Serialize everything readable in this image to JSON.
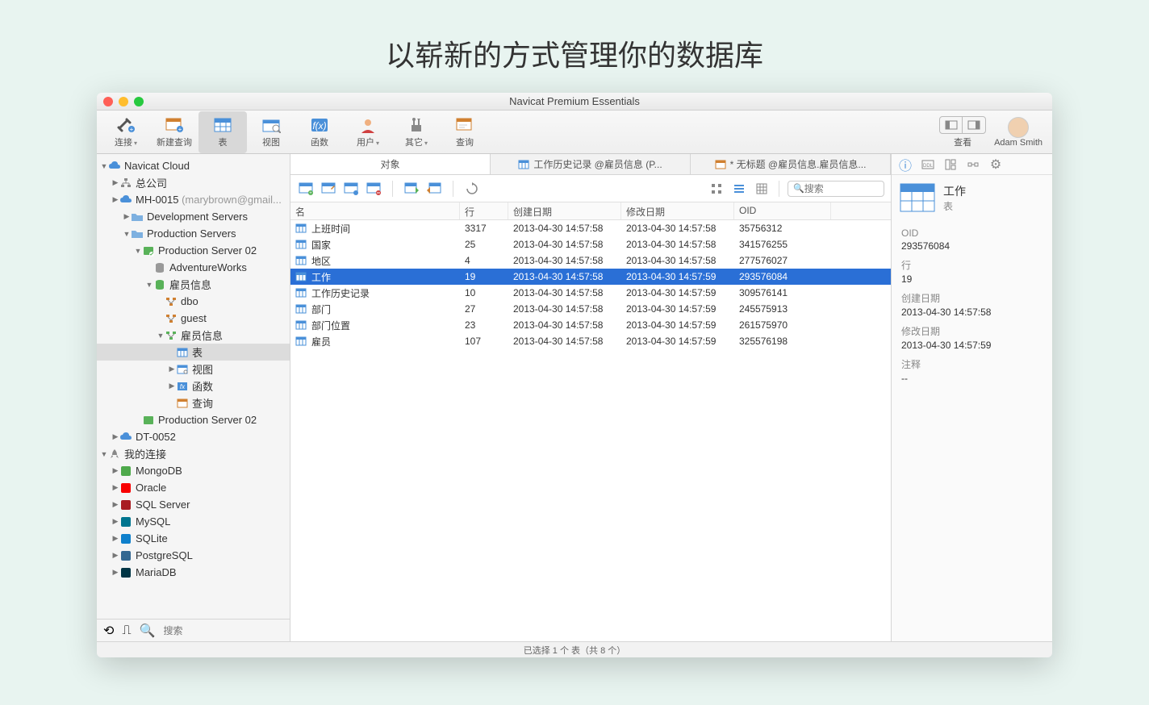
{
  "headline": "以崭新的方式管理你的数据库",
  "window_title": "Navicat Premium Essentials",
  "toolbar": {
    "connect": "连接",
    "newquery": "新建查询",
    "table": "表",
    "view": "视图",
    "function": "函数",
    "user": "用户",
    "other": "其它",
    "query": "查询",
    "viewseg": "查看",
    "username": "Adam Smith"
  },
  "sidebar": {
    "nodes": [
      {
        "d": 0,
        "exp": "▼",
        "icon": "cloud",
        "label": "Navicat Cloud"
      },
      {
        "d": 1,
        "exp": "▶",
        "icon": "org",
        "label": "总公司"
      },
      {
        "d": 1,
        "exp": "▶",
        "icon": "cloud2",
        "label": "MH-0015 ",
        "dim": "(marybrown@gmail..."
      },
      {
        "d": 2,
        "exp": "▶",
        "icon": "folder",
        "label": "Development Servers"
      },
      {
        "d": 2,
        "exp": "▼",
        "icon": "folder",
        "label": "Production Servers"
      },
      {
        "d": 3,
        "exp": "▼",
        "icon": "server-g",
        "label": "Production Server 02"
      },
      {
        "d": 4,
        "exp": "",
        "icon": "db",
        "label": "AdventureWorks"
      },
      {
        "d": 4,
        "exp": "▼",
        "icon": "db-g",
        "label": "雇员信息"
      },
      {
        "d": 5,
        "exp": "",
        "icon": "schema",
        "label": "dbo"
      },
      {
        "d": 5,
        "exp": "",
        "icon": "schema",
        "label": "guest"
      },
      {
        "d": 5,
        "exp": "▼",
        "icon": "schema-g",
        "label": "雇员信息"
      },
      {
        "d": 6,
        "exp": "",
        "icon": "table",
        "label": "表",
        "sel": true
      },
      {
        "d": 6,
        "exp": "▶",
        "icon": "view",
        "label": "视图"
      },
      {
        "d": 6,
        "exp": "▶",
        "icon": "func",
        "label": "函数"
      },
      {
        "d": 6,
        "exp": "",
        "icon": "query",
        "label": "查询"
      },
      {
        "d": 3,
        "exp": "",
        "icon": "server",
        "label": "Production Server 02"
      },
      {
        "d": 1,
        "exp": "▶",
        "icon": "cloud2",
        "label": "DT-0052"
      },
      {
        "d": 0,
        "exp": "▼",
        "icon": "rocket",
        "label": "我的连接"
      },
      {
        "d": 1,
        "exp": "▶",
        "icon": "mongo",
        "label": "MongoDB"
      },
      {
        "d": 1,
        "exp": "▶",
        "icon": "oracle",
        "label": "Oracle"
      },
      {
        "d": 1,
        "exp": "▶",
        "icon": "mssql",
        "label": "SQL Server"
      },
      {
        "d": 1,
        "exp": "▶",
        "icon": "mysql",
        "label": "MySQL"
      },
      {
        "d": 1,
        "exp": "▶",
        "icon": "sqlite",
        "label": "SQLite"
      },
      {
        "d": 1,
        "exp": "▶",
        "icon": "pg",
        "label": "PostgreSQL"
      },
      {
        "d": 1,
        "exp": "▶",
        "icon": "maria",
        "label": "MariaDB"
      }
    ],
    "search_placeholder": "搜索"
  },
  "tabs": [
    {
      "label": "对象",
      "active": true
    },
    {
      "label": "工作历史记录 @雇员信息 (P..."
    },
    {
      "label": "* 无标题 @雇员信息.雇员信息..."
    }
  ],
  "objectbar": {
    "search_placeholder": "搜索"
  },
  "columns": {
    "name": "名",
    "rows": "行",
    "created": "创建日期",
    "modified": "修改日期",
    "oid": "OID"
  },
  "tables": [
    {
      "name": "上班时间",
      "rows": "3317",
      "cd": "2013-04-30 14:57:58",
      "md": "2013-04-30 14:57:58",
      "oid": "35756312"
    },
    {
      "name": "国家",
      "rows": "25",
      "cd": "2013-04-30 14:57:58",
      "md": "2013-04-30 14:57:58",
      "oid": "341576255"
    },
    {
      "name": "地区",
      "rows": "4",
      "cd": "2013-04-30 14:57:58",
      "md": "2013-04-30 14:57:58",
      "oid": "277576027"
    },
    {
      "name": "工作",
      "rows": "19",
      "cd": "2013-04-30 14:57:58",
      "md": "2013-04-30 14:57:59",
      "oid": "293576084",
      "sel": true
    },
    {
      "name": "工作历史记录",
      "rows": "10",
      "cd": "2013-04-30 14:57:58",
      "md": "2013-04-30 14:57:59",
      "oid": "309576141"
    },
    {
      "name": "部门",
      "rows": "27",
      "cd": "2013-04-30 14:57:58",
      "md": "2013-04-30 14:57:59",
      "oid": "245575913"
    },
    {
      "name": "部门位置",
      "rows": "23",
      "cd": "2013-04-30 14:57:58",
      "md": "2013-04-30 14:57:59",
      "oid": "261575970"
    },
    {
      "name": "雇员",
      "rows": "107",
      "cd": "2013-04-30 14:57:58",
      "md": "2013-04-30 14:57:59",
      "oid": "325576198"
    }
  ],
  "info": {
    "title": "工作",
    "subtitle": "表",
    "props": [
      {
        "k": "OID",
        "v": "293576084"
      },
      {
        "k": "行",
        "v": "19"
      },
      {
        "k": "创建日期",
        "v": "2013-04-30 14:57:58"
      },
      {
        "k": "修改日期",
        "v": "2013-04-30 14:57:59"
      },
      {
        "k": "注释",
        "v": "--"
      }
    ]
  },
  "status": "已选择 1 个 表（共 8 个）"
}
